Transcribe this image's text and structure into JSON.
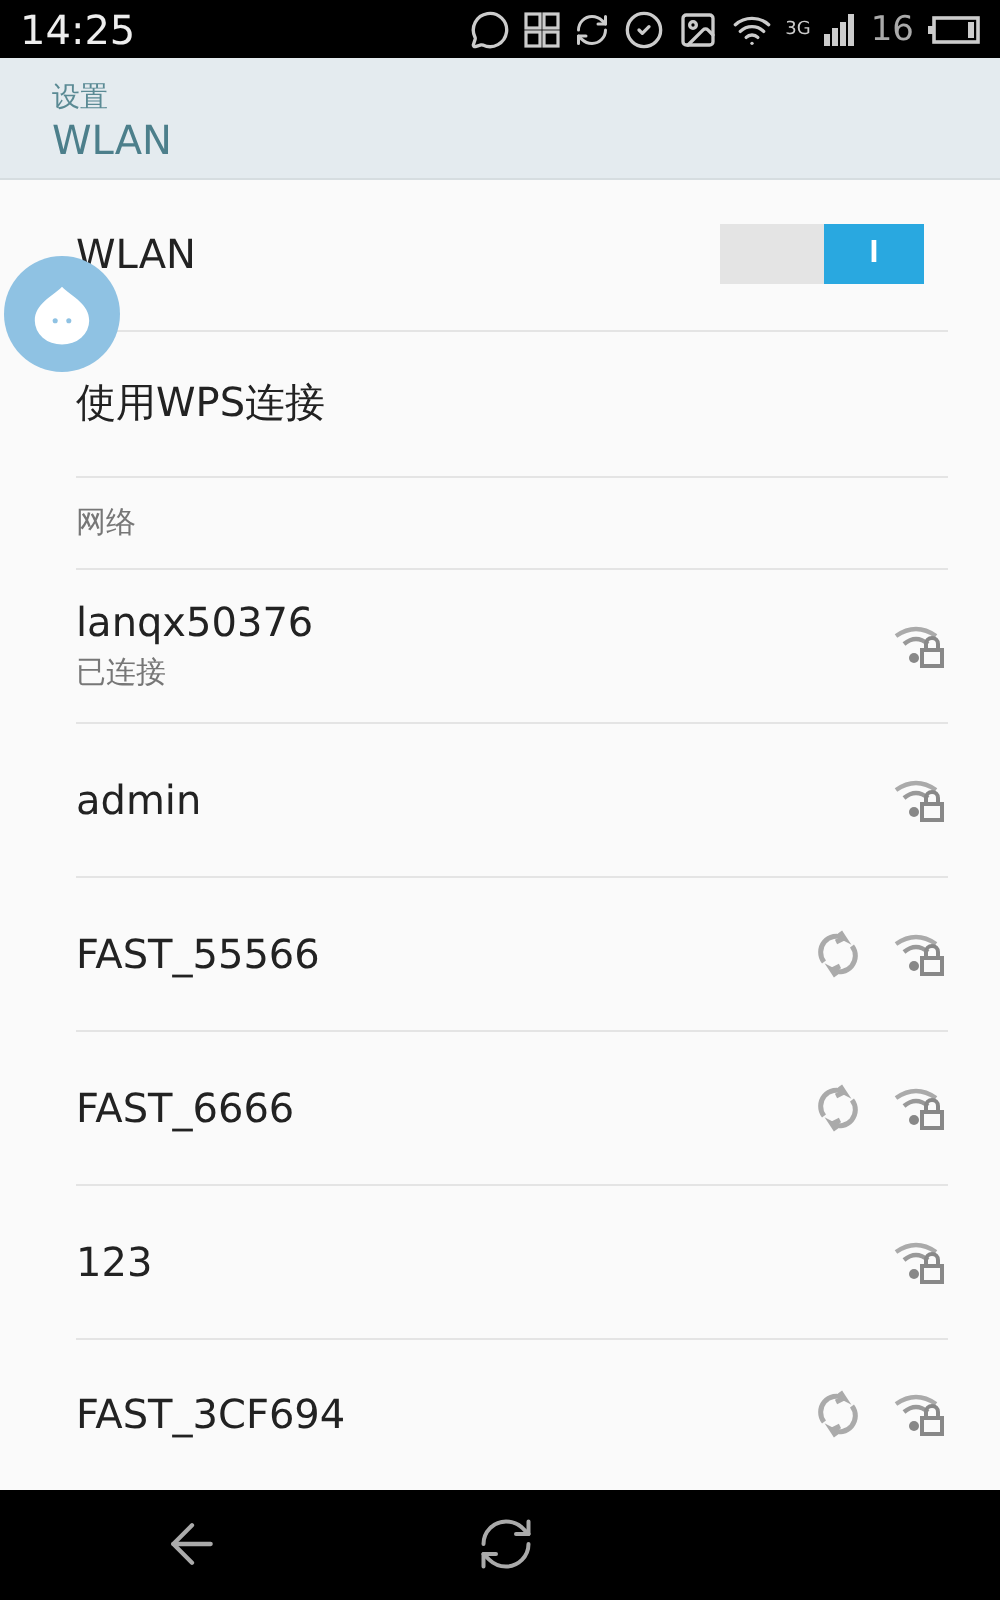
{
  "status_bar": {
    "time": "14:25",
    "network_type": "3G",
    "battery": "16"
  },
  "header": {
    "breadcrumb": "设置",
    "title": "WLAN"
  },
  "wlan_toggle": {
    "label": "WLAN",
    "checked": true,
    "knob": "I"
  },
  "wps": {
    "label": "使用WPS连接"
  },
  "section": {
    "title": "网络"
  },
  "networks": [
    {
      "name": "lanqx50376",
      "status": "已连接",
      "wps": false
    },
    {
      "name": "admin",
      "wps": false
    },
    {
      "name": "FAST_55566",
      "wps": true
    },
    {
      "name": "FAST_6666",
      "wps": true
    },
    {
      "name": "123",
      "wps": false
    },
    {
      "name": "FAST_3CF694",
      "wps": true
    }
  ]
}
